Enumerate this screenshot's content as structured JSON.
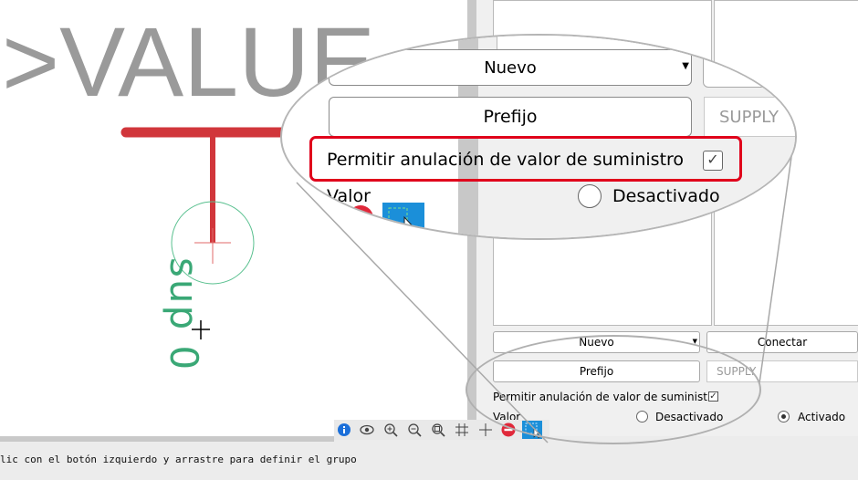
{
  "canvas": {
    "value_text": ">VALUE",
    "pin_text": "sup 0"
  },
  "panel": {
    "nuevo_label": "Nuevo",
    "conectar_label": "Conectar",
    "prefijo_label": "Prefijo",
    "supply_value": "SUPPLY",
    "override_label": "Permitir anulación de valor de suministro",
    "override_checked": "✓",
    "valor_label": "Valor",
    "desactivado_label": "Desactivado",
    "activado_label": "Activado"
  },
  "magnifier": {
    "nuevo_label": "Nuevo",
    "prefijo_label": "Prefijo",
    "supply_value": "SUPPLY",
    "override_label": "Permitir anulación de valor de suministro",
    "override_checked": "✓",
    "valor_label": "Valor",
    "desactivado_label": "Desactivado"
  },
  "toolbar": {
    "icons": [
      "info-icon",
      "eye-icon",
      "zoom-in-icon",
      "zoom-out-icon",
      "zoom-fit-icon",
      "grid-icon",
      "crosshair-icon",
      "stop-icon",
      "select-group-icon"
    ]
  },
  "status": {
    "message": "lic con el botón izquierdo y arrastre para definir el grupo"
  },
  "colors": {
    "wire": "#d1363b",
    "pin": "#3aa876",
    "callout": "#e0001b",
    "select_tool": "#1b8fd9"
  }
}
